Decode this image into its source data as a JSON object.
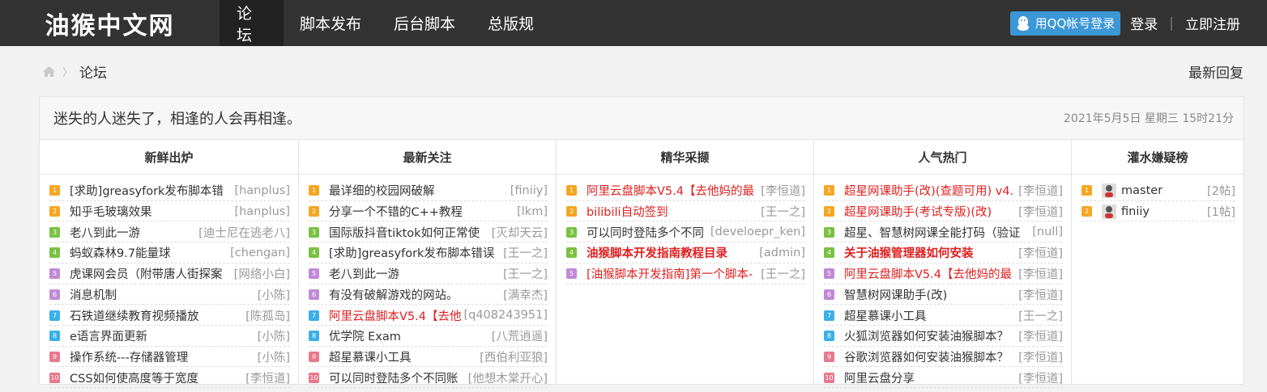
{
  "site": {
    "logo": "油猴中文网"
  },
  "nav": [
    {
      "label": "论坛",
      "active": true
    },
    {
      "label": "脚本发布"
    },
    {
      "label": "后台脚本"
    },
    {
      "label": "总版规"
    }
  ],
  "auth": {
    "qq_login": "用QQ帐号登录",
    "login": "登录",
    "divider": "|",
    "register": "立即注册"
  },
  "breadcrumb": {
    "current": "论坛",
    "latest_reply": "最新回复"
  },
  "motto": "迷失的人迷失了，相逢的人会再相逢。",
  "date": "2021年5月5日 星期三 15时21分",
  "colors": {
    "n1": "#f5a623",
    "n2": "#f5a623",
    "n3": "#7ac143",
    "n4": "#7ac143",
    "n5": "#c08ad6",
    "n6": "#c08ad6",
    "n7": "#3ab0e6",
    "n8": "#3ab0e6",
    "n9": "#e8788c",
    "n10": "#e8788c"
  },
  "columns": [
    {
      "title": "新鲜出炉",
      "items": [
        {
          "n": "1",
          "title": "[求助]greasyfork发布脚本错",
          "author": "[hanplus]"
        },
        {
          "n": "2",
          "title": "知乎毛玻璃效果",
          "author": "[hanplus]"
        },
        {
          "n": "3",
          "title": "老八到此一游",
          "author": "[迪士尼在逃老八]"
        },
        {
          "n": "4",
          "title": "蚂蚁森林9.7能量球",
          "author": "[chengan]"
        },
        {
          "n": "5",
          "title": "虎课网会员（附带唐人街探案",
          "author": "[网络小白]"
        },
        {
          "n": "6",
          "title": "消息机制",
          "author": "[小陈]"
        },
        {
          "n": "7",
          "title": "石铁道继续教育视频播放",
          "author": "[陈孤岛]"
        },
        {
          "n": "8",
          "title": "e语言界面更新",
          "author": "[小陈]"
        },
        {
          "n": "9",
          "title": "操作系统---存储器管理",
          "author": "[小陈]"
        },
        {
          "n": "10",
          "title": "CSS如何使高度等于宽度",
          "author": "[李恒道]"
        }
      ]
    },
    {
      "title": "最新关注",
      "items": [
        {
          "n": "1",
          "title": "最详细的校园网破解",
          "author": "[finiiy]"
        },
        {
          "n": "2",
          "title": "分享一个不错的C++教程",
          "author": "[lkm]"
        },
        {
          "n": "3",
          "title": "国际版抖音tiktok如何正常使",
          "author": "[灭却天云]"
        },
        {
          "n": "4",
          "title": "[求助]greasyfork发布脚本错误",
          "author": "[王一之]"
        },
        {
          "n": "5",
          "title": "老八到此一游",
          "author": "[王一之]"
        },
        {
          "n": "6",
          "title": "有没有破解游戏的网站。",
          "author": "[满幸杰]"
        },
        {
          "n": "7",
          "title": "阿里云盘脚本V5.4【去他",
          "author": "[q408243951]",
          "red": true
        },
        {
          "n": "8",
          "title": "优学院 Exam",
          "author": "[八荒逍遥]"
        },
        {
          "n": "9",
          "title": "超星慕课小工具",
          "author": "[西伯利亚狼]"
        },
        {
          "n": "10",
          "title": "可以同时登陆多个不同账",
          "author": "[他想木棠开心]"
        }
      ]
    },
    {
      "title": "精华采撷",
      "items": [
        {
          "n": "1",
          "title": "阿里云盘脚本V5.4【去他妈的最",
          "author": "[李恒道]",
          "red": true
        },
        {
          "n": "2",
          "title": "bilibili自动签到",
          "author": "[王一之]",
          "red": true
        },
        {
          "n": "3",
          "title": "可以同时登陆多个不同",
          "author": "[develoepr_ken]"
        },
        {
          "n": "4",
          "title": "油猴脚本开发指南教程目录",
          "author": "[admin]",
          "red": true,
          "bold": true
        },
        {
          "n": "5",
          "title": "[油猴脚本开发指南]第一个脚本-",
          "author": "[王一之]",
          "red": true
        }
      ]
    },
    {
      "title": "人气热门",
      "items": [
        {
          "n": "1",
          "title": "超星网课助手(改)(查题可用) v4.",
          "author": "[李恒道]",
          "red": true
        },
        {
          "n": "2",
          "title": "超星网课助手(考试专版)(改)",
          "author": "[李恒道]",
          "red": true
        },
        {
          "n": "3",
          "title": "超星、智慧树网课全能打码（验证",
          "author": "[null]"
        },
        {
          "n": "4",
          "title": "关于油猴管理器如何安装",
          "author": "[李恒道]",
          "red": true,
          "bold": true
        },
        {
          "n": "5",
          "title": "阿里云盘脚本V5.4【去他妈的最",
          "author": "[李恒道]",
          "red": true
        },
        {
          "n": "6",
          "title": "智慧树网课助手(改)",
          "author": "[李恒道]"
        },
        {
          "n": "7",
          "title": "超星慕课小工具",
          "author": "[王一之]"
        },
        {
          "n": "8",
          "title": "火狐浏览器如何安装油猴脚本？",
          "author": "[李恒道]"
        },
        {
          "n": "9",
          "title": "谷歌浏览器如何安装油猴脚本？",
          "author": "[李恒道]"
        },
        {
          "n": "10",
          "title": "阿里云盘分享",
          "author": "[李恒道]"
        }
      ]
    },
    {
      "title": "灌水嫌疑榜",
      "items": [
        {
          "n": "1",
          "title": "master",
          "author": "[2帖]",
          "avatar": true
        },
        {
          "n": "2",
          "title": "finiiy",
          "author": "[1帖]",
          "avatar": true
        }
      ]
    }
  ]
}
